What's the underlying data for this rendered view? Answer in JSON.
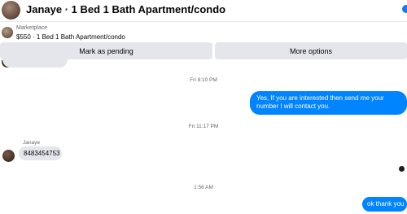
{
  "header": {
    "title": "Janaye · 1 Bed 1 Bath Apartment/condo"
  },
  "listing": {
    "section_label": "Marketplace",
    "description": "$550 · 1 Bed 1 Bath Apartment/condo"
  },
  "actions": {
    "mark_pending": "Mark as pending",
    "more_options": "More options"
  },
  "messages": [
    {
      "timestamp": "Fri 8:10 PM",
      "direction": "outgoing",
      "text": "Yes, If you are interested then send me your number I will contact you."
    },
    {
      "timestamp": "Fri 11:17 PM",
      "direction": "incoming",
      "sender": "Janaye",
      "text": "8483454753"
    },
    {
      "timestamp": "1:56 AM",
      "direction": "outgoing",
      "text": "ok thank you"
    }
  ],
  "colors": {
    "outgoing_bubble": "#0084ff",
    "incoming_bubble": "#e4e6eb",
    "button_bg": "#e4e6eb",
    "meta_text": "#65676b"
  }
}
